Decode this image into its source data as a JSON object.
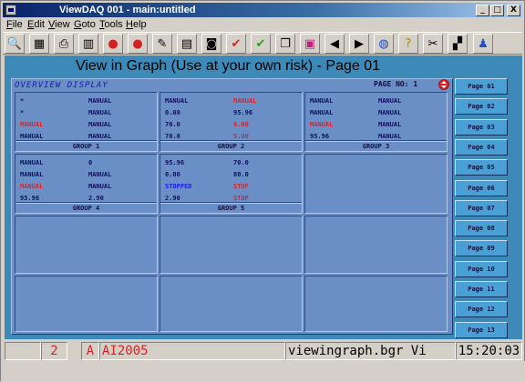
{
  "window": {
    "title": "ViewDAQ 001 - main:untitled",
    "minimize": "_",
    "maximize": "□",
    "close": "X"
  },
  "menu": [
    {
      "label": "File",
      "ul": "F"
    },
    {
      "label": "Edit",
      "ul": "E"
    },
    {
      "label": "View",
      "ul": "V"
    },
    {
      "label": "Goto",
      "ul": "G"
    },
    {
      "label": "Tools",
      "ul": "T"
    },
    {
      "label": "Help",
      "ul": "H"
    }
  ],
  "toolbar": {
    "icons": [
      "magnifier-icon",
      "calculator-icon",
      "printer-icon",
      "chart-icon",
      "red-bulb-icon",
      "red-bulb2-icon",
      "pencil-icon",
      "folder-edit-icon",
      "camera-icon",
      "check-chart-icon",
      "check-green-icon",
      "copy-icon",
      "colorblocks-icon",
      "arrow-left-icon",
      "arrow-right-icon",
      "globe-icon",
      "help-icon",
      "tools-icon",
      "clapper-icon",
      "person-icon"
    ]
  },
  "main": {
    "title": "View in Graph (Use at your own risk) - Page 01"
  },
  "overview": {
    "header": "OVERVIEW DISPLAY",
    "page_no_label": "PAGE NO:",
    "page_no": "1"
  },
  "groups": [
    {
      "name": "GROUP 1",
      "rows": [
        [
          "*",
          "MANUAL"
        ],
        [
          "*",
          "MANUAL"
        ],
        [
          "MANUAL",
          "MANUAL"
        ],
        [
          "MANUAL",
          "MANUAL"
        ]
      ],
      "red": [
        [
          false,
          false
        ],
        [
          false,
          false
        ],
        [
          true,
          false
        ],
        [
          false,
          false
        ]
      ]
    },
    {
      "name": "GROUP 2",
      "rows": [
        [
          "MANUAL",
          "MANUAL"
        ],
        [
          "0.00",
          "95.96"
        ],
        [
          "70.0",
          "0.00"
        ],
        [
          "70.0",
          "5.00"
        ]
      ],
      "red": [
        [
          false,
          true
        ],
        [
          false,
          false
        ],
        [
          false,
          true
        ],
        [
          false,
          true
        ]
      ]
    },
    {
      "name": "GROUP 3",
      "rows": [
        [
          "MANUAL",
          "MANUAL"
        ],
        [
          "MANUAL",
          "MANUAL"
        ],
        [
          "MANUAL",
          "MANUAL"
        ],
        [
          "95.96",
          "MANUAL"
        ]
      ],
      "red": [
        [
          false,
          false
        ],
        [
          false,
          false
        ],
        [
          true,
          false
        ],
        [
          false,
          false
        ]
      ]
    },
    {
      "name": "GROUP 4",
      "rows": [
        [
          "MANUAL",
          "0"
        ],
        [
          "MANUAL",
          "MANUAL"
        ],
        [
          "MANUAL",
          "MANUAL"
        ],
        [
          "95.96",
          "2.90"
        ]
      ],
      "red": [
        [
          false,
          false
        ],
        [
          false,
          false
        ],
        [
          true,
          false
        ],
        [
          false,
          false
        ]
      ]
    },
    {
      "name": "GROUP 5",
      "rows": [
        [
          "95.96",
          "70.0"
        ],
        [
          "0.00",
          "80.0"
        ],
        [
          "STOPPED",
          "STOP"
        ],
        [
          "2.90",
          "STOP"
        ]
      ],
      "red": [
        [
          false,
          false
        ],
        [
          false,
          false
        ],
        [
          false,
          true
        ],
        [
          false,
          true
        ]
      ],
      "blue": [
        [
          false,
          false
        ],
        [
          false,
          false
        ],
        [
          true,
          false
        ],
        [
          false,
          false
        ]
      ]
    }
  ],
  "pages": [
    "Page 01",
    "Page 02",
    "Page 03",
    "Page 04",
    "Page 05",
    "Page 06",
    "Page 07",
    "Page 08",
    "Page 09",
    "Page 10",
    "Page 11",
    "Page 12",
    "Page 13"
  ],
  "status": {
    "f2": "2",
    "f3": "A",
    "f4": "AI2005",
    "f5": "viewingraph.bgr Vi",
    "f6": "15:20:03"
  },
  "colors": {
    "panel": "#3d8ab8",
    "cell": "#6a8fc6",
    "alarm": "#e82020"
  }
}
